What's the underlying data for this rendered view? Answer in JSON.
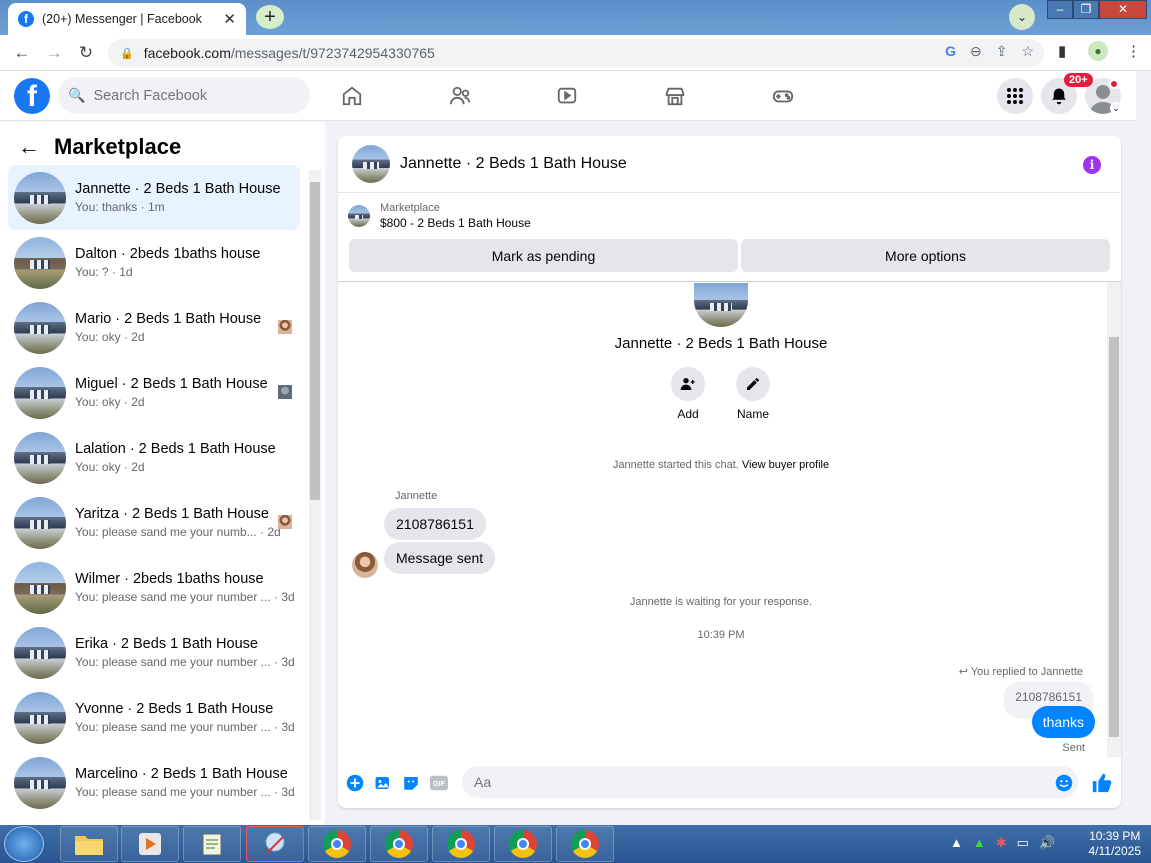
{
  "browser": {
    "tab_title": "(20+) Messenger | Facebook",
    "url_host": "facebook.com",
    "url_path": "/messages/t/9723742954330765"
  },
  "header": {
    "search_placeholder": "Search Facebook",
    "notif_badge": "20+"
  },
  "left": {
    "title": "Marketplace",
    "conversations": [
      {
        "name": "Jannette · 2 Beds 1 Bath House",
        "sub": "You: thanks · 1m",
        "active": true
      },
      {
        "name": "Dalton · 2beds 1baths house",
        "sub": "You: ? · 1d"
      },
      {
        "name": "Mario · 2 Beds 1 Bath House",
        "sub": "You: oky · 2d"
      },
      {
        "name": "Miguel · 2 Beds 1 Bath House",
        "sub": "You: oky · 2d"
      },
      {
        "name": "Lalation · 2 Beds 1 Bath House",
        "sub": "You: oky · 2d"
      },
      {
        "name": "Yaritza · 2 Beds 1 Bath House",
        "sub": "You: please sand me your numb... · 2d"
      },
      {
        "name": "Wilmer · 2beds 1baths house",
        "sub": "You: please sand me your number ... · 3d"
      },
      {
        "name": "Erika · 2 Beds 1 Bath House",
        "sub": "You: please sand me your number ... · 3d"
      },
      {
        "name": "Yvonne · 2 Beds 1 Bath House",
        "sub": "You: please sand me your number ... · 3d"
      },
      {
        "name": "Marcelino · 2 Beds 1 Bath House",
        "sub": "You: please sand me your number ... · 3d"
      }
    ]
  },
  "chat": {
    "title": "Jannette · 2 Beds 1 Bath House",
    "marketplace_label": "Marketplace",
    "listing": "$800 - 2 Beds 1 Bath House",
    "mark_pending": "Mark as pending",
    "more_options": "More options",
    "add_label": "Add",
    "name_label": "Name",
    "started_text": "Jannette started this chat.",
    "view_profile": "View buyer profile",
    "sender_name": "Jannette",
    "incoming": [
      "2108786151",
      "Message sent"
    ],
    "waiting_text": "Jannette is waiting for your response.",
    "timestamp": "10:39 PM",
    "replied_to": "You replied to Jannette",
    "quoted": "2108786151",
    "outgoing": "thanks",
    "sent": "Sent",
    "composer_placeholder": "Aa"
  },
  "taskbar": {
    "time": "10:39 PM",
    "date": "4/11/2025"
  },
  "colors": {
    "brand": "#1877f2",
    "outgoing_bubble": "#0084ff",
    "info_icon": "#a034ee",
    "badge": "#e41e3f"
  }
}
